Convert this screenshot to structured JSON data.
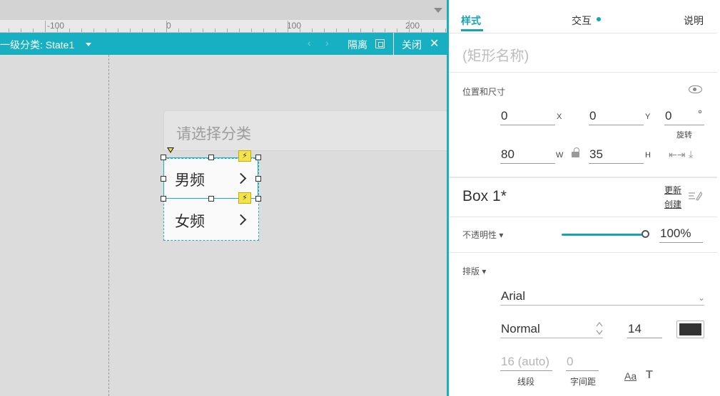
{
  "canvas": {
    "ruler_labels": [
      "-100",
      "0",
      "100",
      "200"
    ],
    "state_bar": {
      "title": "一级分类: State1",
      "prev_icon": "chevron-left-icon",
      "next_icon": "chevron-right-icon",
      "isolate_label": "隔离",
      "close_label": "关闭"
    },
    "dropdown_placeholder": "请选择分类",
    "repeater_items": [
      {
        "label": "男频"
      },
      {
        "label": "女频"
      }
    ],
    "accent_color": "#16b0c2",
    "interaction_marker_color": "#f2e44a"
  },
  "panel": {
    "tabs": [
      {
        "label": "样式",
        "active": true
      },
      {
        "label": "交互",
        "has_dot": true
      },
      {
        "label": "说明"
      }
    ],
    "shape_name_placeholder": "(矩形名称)",
    "position_size": {
      "label": "位置和尺寸",
      "x": "0",
      "x_unit": "X",
      "y": "0",
      "y_unit": "Y",
      "rotation": "0",
      "rotation_unit": "°",
      "rotation_label": "旋转",
      "width": "80",
      "width_unit": "W",
      "height": "35",
      "height_unit": "H"
    },
    "style": {
      "name": "Box 1*",
      "update_label": "更新",
      "create_label": "创建"
    },
    "opacity": {
      "label": "不透明性",
      "value": "100%",
      "fraction": 1.0
    },
    "typography": {
      "label": "排版",
      "font_family": "Arial",
      "font_weight": "Normal",
      "font_size": "14",
      "font_color": "#333333",
      "line_spacing": "16 (auto)",
      "line_spacing_label": "线段",
      "letter_spacing": "0",
      "letter_spacing_label": "字间距",
      "case_icon_text": "Aa",
      "shadow_icon_text": "T"
    }
  }
}
